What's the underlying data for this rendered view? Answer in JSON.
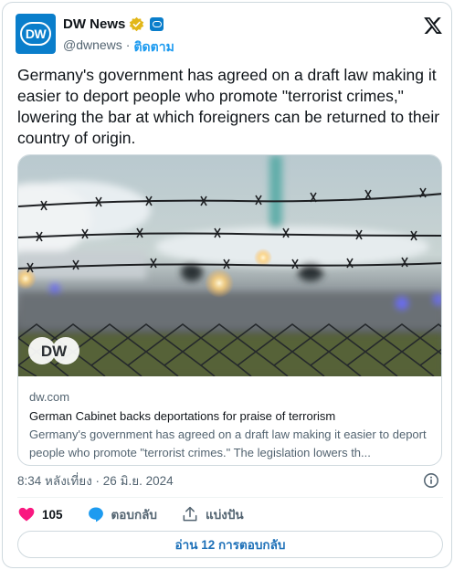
{
  "account": {
    "name": "DW News",
    "handle": "@dwnews",
    "separator": "·",
    "follow_label": "ติดตาม",
    "avatar_text": "DW"
  },
  "tweet": {
    "text": "Germany's government has agreed on a draft law making it easier to deport people who promote \"terrorist crimes,\" lowering the bar at which foreigners can be returned to their country of origin.",
    "timestamp": "8:34 หลังเที่ยง · 26 มิ.ย. 2024"
  },
  "link_card": {
    "image_watermark": "DW",
    "domain": "dw.com",
    "title": "German Cabinet backs deportations for praise of terrorism",
    "description": "Germany's government has agreed on a draft law making it easier to deport people who promote \"terrorist crimes.\" The legislation lowers th..."
  },
  "actions": {
    "like_count": "105",
    "reply_label": "ตอบกลับ",
    "share_label": "แบ่งปัน"
  },
  "replies_button": "อ่าน 12 การตอบกลับ",
  "colors": {
    "brand_blue": "#0a7ecb",
    "link_blue": "#1d9bf0",
    "like_pink": "#f91880",
    "verified_gold": "#e2b719"
  },
  "icons": [
    "verified-badge-icon",
    "affiliate-dw-icon",
    "x-logo-icon",
    "info-icon",
    "heart-icon",
    "reply-bubble-icon",
    "share-icon"
  ]
}
